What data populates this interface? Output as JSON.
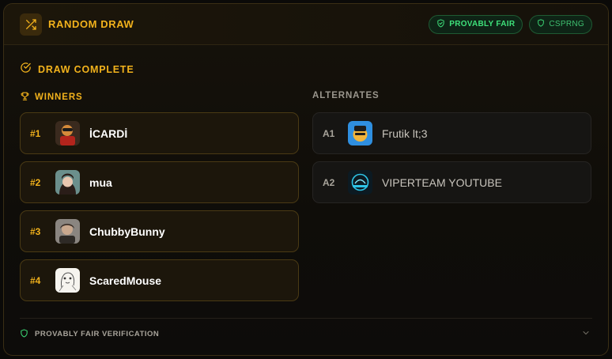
{
  "header": {
    "title": "RANDOM DRAW",
    "icon": "shuffle-icon",
    "badges": [
      {
        "label": "PROVABLY FAIR",
        "icon": "shield-check-icon"
      },
      {
        "label": "CSPRNG",
        "icon": "shield-icon"
      }
    ]
  },
  "status": {
    "label": "DRAW COMPLETE",
    "icon": "check-circle-icon"
  },
  "winners": {
    "title": "WINNERS",
    "icon": "trophy-icon",
    "items": [
      {
        "rank": "#1",
        "name": "İCARDİ"
      },
      {
        "rank": "#2",
        "name": "mua"
      },
      {
        "rank": "#3",
        "name": "ChubbyBunny"
      },
      {
        "rank": "#4",
        "name": "ScaredMouse"
      }
    ]
  },
  "alternates": {
    "title": "ALTERNATES",
    "items": [
      {
        "rank": "A1",
        "name": "Frutik lt;3"
      },
      {
        "rank": "A2",
        "name": "VIPERTEAM YOUTUBE"
      }
    ]
  },
  "footer": {
    "label": "PROVABLY FAIR VERIFICATION",
    "icon": "shield-icon"
  },
  "colors": {
    "accent": "#f2b21c",
    "success": "#3ee07a",
    "background": "#0b0a08"
  }
}
